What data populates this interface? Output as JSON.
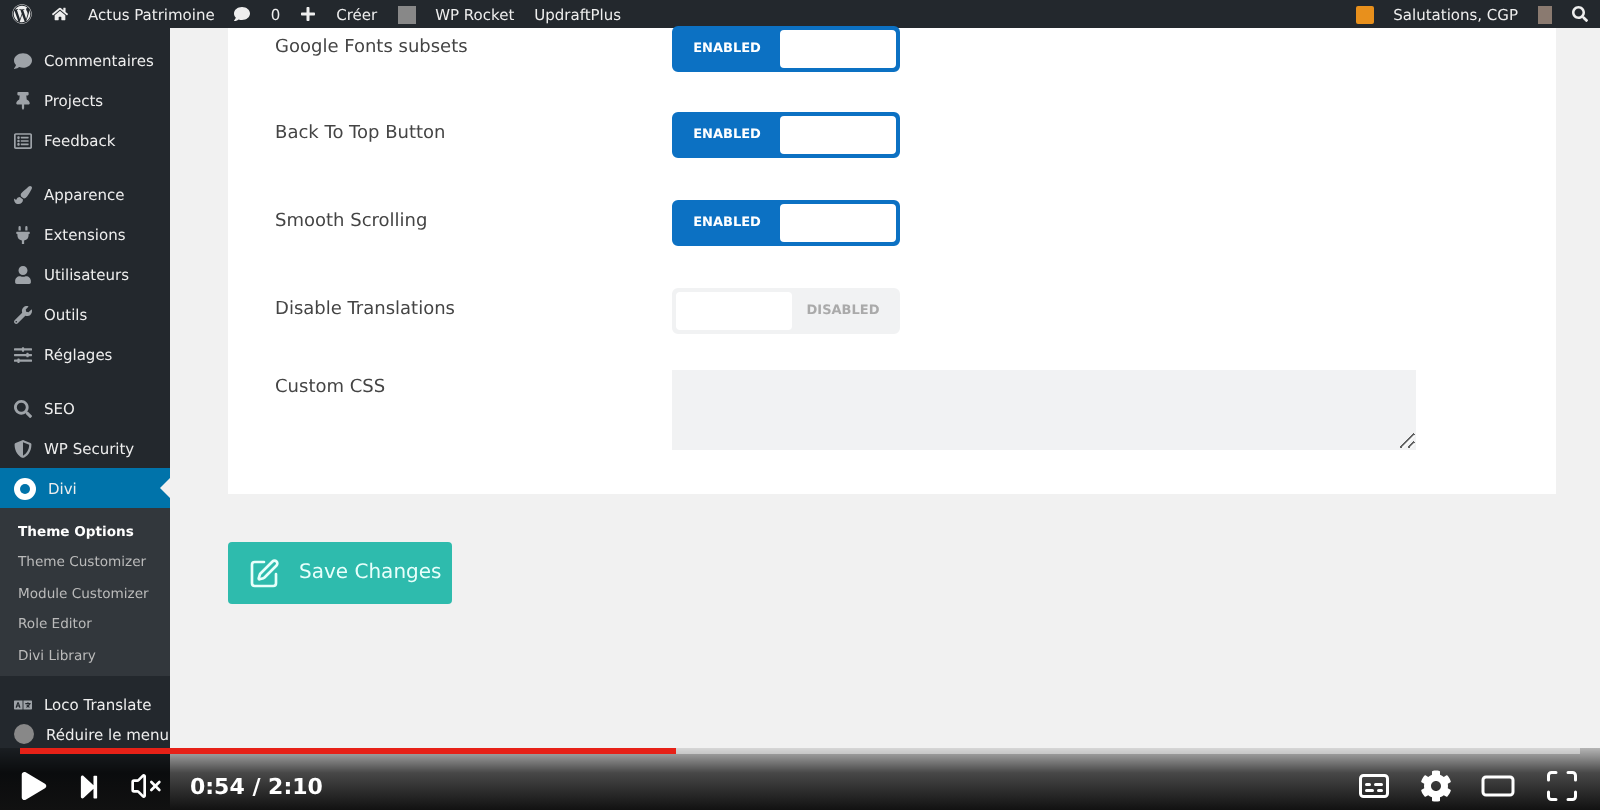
{
  "admin_bar": {
    "items": [
      {
        "kind": "logo"
      },
      {
        "kind": "home",
        "label": "Actus Patrimoine"
      },
      {
        "kind": "comments",
        "label": "0"
      },
      {
        "kind": "new",
        "label": "Créer"
      },
      {
        "kind": "plugin"
      },
      {
        "kind": "text",
        "label": "WP Rocket"
      },
      {
        "kind": "text",
        "label": "UpdraftPlus"
      }
    ],
    "greeting": "Salutations, CGP"
  },
  "sidebar": {
    "groups": [
      [
        {
          "kind": "comments",
          "label": "Commentaires",
          "selected": false
        },
        {
          "kind": "pin",
          "label": "Projects",
          "selected": false
        },
        {
          "kind": "feedback",
          "label": "Feedback",
          "selected": false
        }
      ],
      [
        {
          "kind": "brush",
          "label": "Apparence",
          "selected": false
        },
        {
          "kind": "plug",
          "label": "Extensions",
          "selected": false
        },
        {
          "kind": "user",
          "label": "Utilisateurs",
          "selected": false
        },
        {
          "kind": "wrench",
          "label": "Outils",
          "selected": false
        },
        {
          "kind": "sliders",
          "label": "Réglages",
          "selected": false
        }
      ],
      [
        {
          "kind": "seo",
          "label": "SEO",
          "selected": false
        },
        {
          "kind": "shield",
          "label": "WP Security",
          "selected": false
        },
        {
          "kind": "divi",
          "label": "Divi",
          "selected": true
        }
      ]
    ],
    "submenu": [
      {
        "label": "Theme Options",
        "selected": true
      },
      {
        "label": "Theme Customizer",
        "selected": false
      },
      {
        "label": "Module Customizer",
        "selected": false
      },
      {
        "label": "Role Editor",
        "selected": false
      },
      {
        "label": "Divi Library",
        "selected": false
      }
    ],
    "footer_items": [
      {
        "kind": "translate",
        "label": "Loco Translate"
      },
      {
        "kind": "collapse",
        "label": "Réduire le menu"
      }
    ]
  },
  "settings": [
    {
      "kind": "toggle",
      "label": "Google Fonts subsets",
      "on": true,
      "state_label": "ENABLED"
    },
    {
      "kind": "toggle",
      "label": "Back To Top Button",
      "on": true,
      "state_label": "ENABLED"
    },
    {
      "kind": "toggle",
      "label": "Smooth Scrolling",
      "on": true,
      "state_label": "ENABLED"
    },
    {
      "kind": "toggle",
      "label": "Disable Translations",
      "on": false,
      "state_label": "DISABLED"
    },
    {
      "kind": "textarea",
      "label": "Custom CSS"
    }
  ],
  "save_button": {
    "label": "Save Changes"
  },
  "player": {
    "level": 0.42,
    "time": "0:54 / 2:10"
  }
}
